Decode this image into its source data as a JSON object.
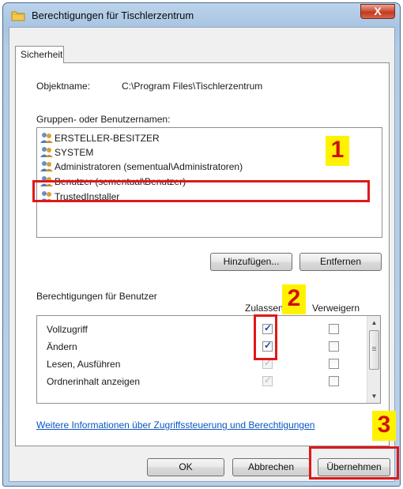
{
  "window": {
    "title": "Berechtigungen für Tischlerzentrum",
    "close_label": "X"
  },
  "tab": {
    "label": "Sicherheit"
  },
  "object": {
    "label": "Objektname:",
    "value": "C:\\Program Files\\Tischlerzentrum"
  },
  "groups": {
    "label": "Gruppen- oder Benutzernamen:",
    "items": [
      {
        "name": "ERSTELLER-BESITZER"
      },
      {
        "name": "SYSTEM"
      },
      {
        "name": "Administratoren (sementual\\Administratoren)"
      },
      {
        "name": "Benutzer (sementual\\Benutzer)"
      },
      {
        "name": "TrustedInstaller"
      }
    ],
    "add_button": "Hinzufügen...",
    "remove_button": "Entfernen"
  },
  "permissions": {
    "label": "Berechtigungen für Benutzer",
    "col_allow": "Zulassen",
    "col_deny": "Verweigern",
    "rows": [
      {
        "name": "Vollzugriff",
        "allow": true,
        "allow_inherited": false,
        "deny": false
      },
      {
        "name": "Ändern",
        "allow": true,
        "allow_inherited": false,
        "deny": false
      },
      {
        "name": "Lesen, Ausführen",
        "allow": true,
        "allow_inherited": true,
        "deny": false
      },
      {
        "name": "Ordnerinhalt anzeigen",
        "allow": true,
        "allow_inherited": true,
        "deny": false
      }
    ]
  },
  "info_link": "Weitere Informationen über Zugriffssteuerung und Berechtigungen",
  "buttons": {
    "ok": "OK",
    "cancel": "Abbrechen",
    "apply": "Übernehmen"
  },
  "markers": [
    "1",
    "2",
    "3"
  ],
  "colors": {
    "marker_bg": "#fff200",
    "marker_text": "#d01010",
    "highlight_border": "#e01818",
    "link": "#0a56c2"
  }
}
